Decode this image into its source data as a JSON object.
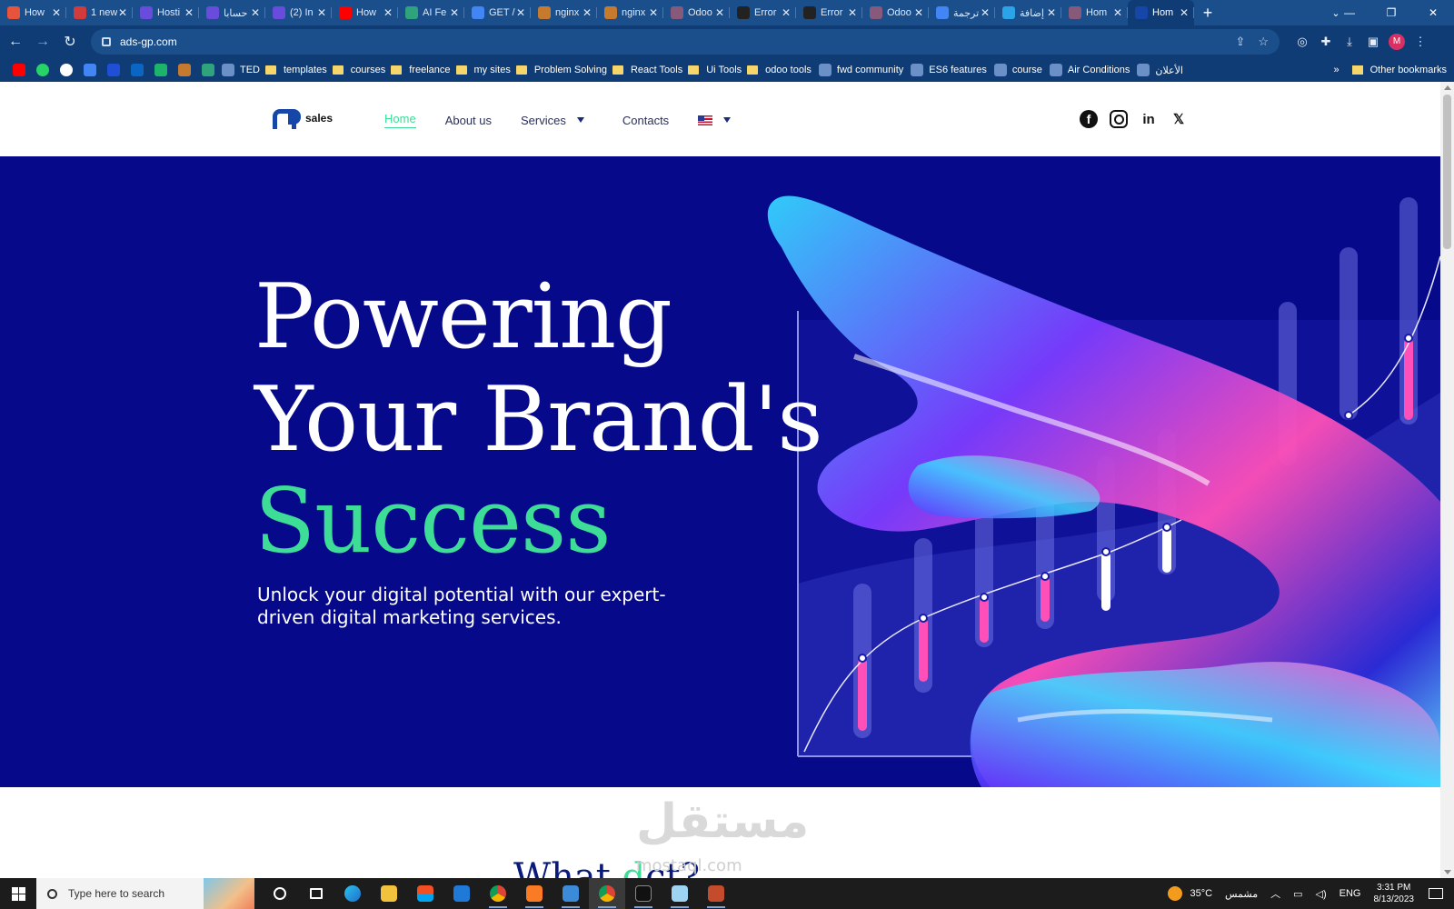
{
  "browser": {
    "tabs": [
      {
        "title": "How",
        "color": "#e8533b"
      },
      {
        "title": "1 new",
        "color": "#d23b3b"
      },
      {
        "title": "Hosti",
        "color": "#6a4cdc"
      },
      {
        "title": "حسابا",
        "color": "#6a4cdc"
      },
      {
        "title": "(2) In",
        "color": "#6a4cdc"
      },
      {
        "title": "How",
        "color": "#ff0000"
      },
      {
        "title": "AI Fe",
        "color": "#2fa37b"
      },
      {
        "title": "GET /",
        "color": "#4285f4"
      },
      {
        "title": "nginx",
        "color": "#c57a2d"
      },
      {
        "title": "nginx",
        "color": "#c57a2d"
      },
      {
        "title": "Odoo",
        "color": "#875a7b"
      },
      {
        "title": "Error",
        "color": "#222222"
      },
      {
        "title": "Error",
        "color": "#222222"
      },
      {
        "title": "Odoo",
        "color": "#875a7b"
      },
      {
        "title": "ترجمة",
        "color": "#4285f4"
      },
      {
        "title": "إضافة",
        "color": "#2aa3e8"
      },
      {
        "title": "Hom",
        "color": "#875a7b"
      },
      {
        "title": "Hom",
        "color": "#1646a8",
        "active": true
      }
    ],
    "new_tab": "+",
    "url": "ads-gp.com",
    "bookmarks": [
      {
        "label": "TED",
        "type": "site"
      },
      {
        "label": "templates",
        "type": "folder"
      },
      {
        "label": "courses",
        "type": "folder"
      },
      {
        "label": "freelance",
        "type": "folder"
      },
      {
        "label": "my sites",
        "type": "folder"
      },
      {
        "label": "Problem Solving",
        "type": "folder"
      },
      {
        "label": "React Tools",
        "type": "folder"
      },
      {
        "label": "Ui Tools",
        "type": "folder"
      },
      {
        "label": "odoo tools",
        "type": "folder"
      },
      {
        "label": "fwd community",
        "type": "site"
      },
      {
        "label": "ES6 features",
        "type": "site"
      },
      {
        "label": "course",
        "type": "site"
      },
      {
        "label": "Air Conditions",
        "type": "site"
      },
      {
        "label": "الأعلان",
        "type": "site"
      }
    ],
    "bookmarks_overflow": "»",
    "other_bookmarks": "Other bookmarks",
    "profile_initial": "M"
  },
  "site": {
    "logo_word": "sales",
    "nav": {
      "home": "Home",
      "about": "About us",
      "services": "Services",
      "contacts": "Contacts"
    },
    "socials": [
      "facebook",
      "instagram",
      "linkedin",
      "x"
    ],
    "hero": {
      "line1": "Powering",
      "line2": "Your Brand's",
      "line3": "Success",
      "subtitle": "Unlock your digital potential with our expert-driven digital marketing services."
    },
    "next_section": {
      "title_part1": "What ",
      "title_part2": "d",
      "title_part3": "ct?"
    },
    "watermark": "مستقل",
    "watermark_url": "mostaql.com"
  },
  "colors": {
    "hero_bg": "#060a8a",
    "accent_green": "#3ddc97",
    "brand_blue": "#1646a8"
  },
  "taskbar": {
    "search_placeholder": "Type here to search",
    "weather": "35°C",
    "weather_desc": "مشمس",
    "language": "ENG",
    "time": "3:31 PM",
    "date": "8/13/2023"
  }
}
